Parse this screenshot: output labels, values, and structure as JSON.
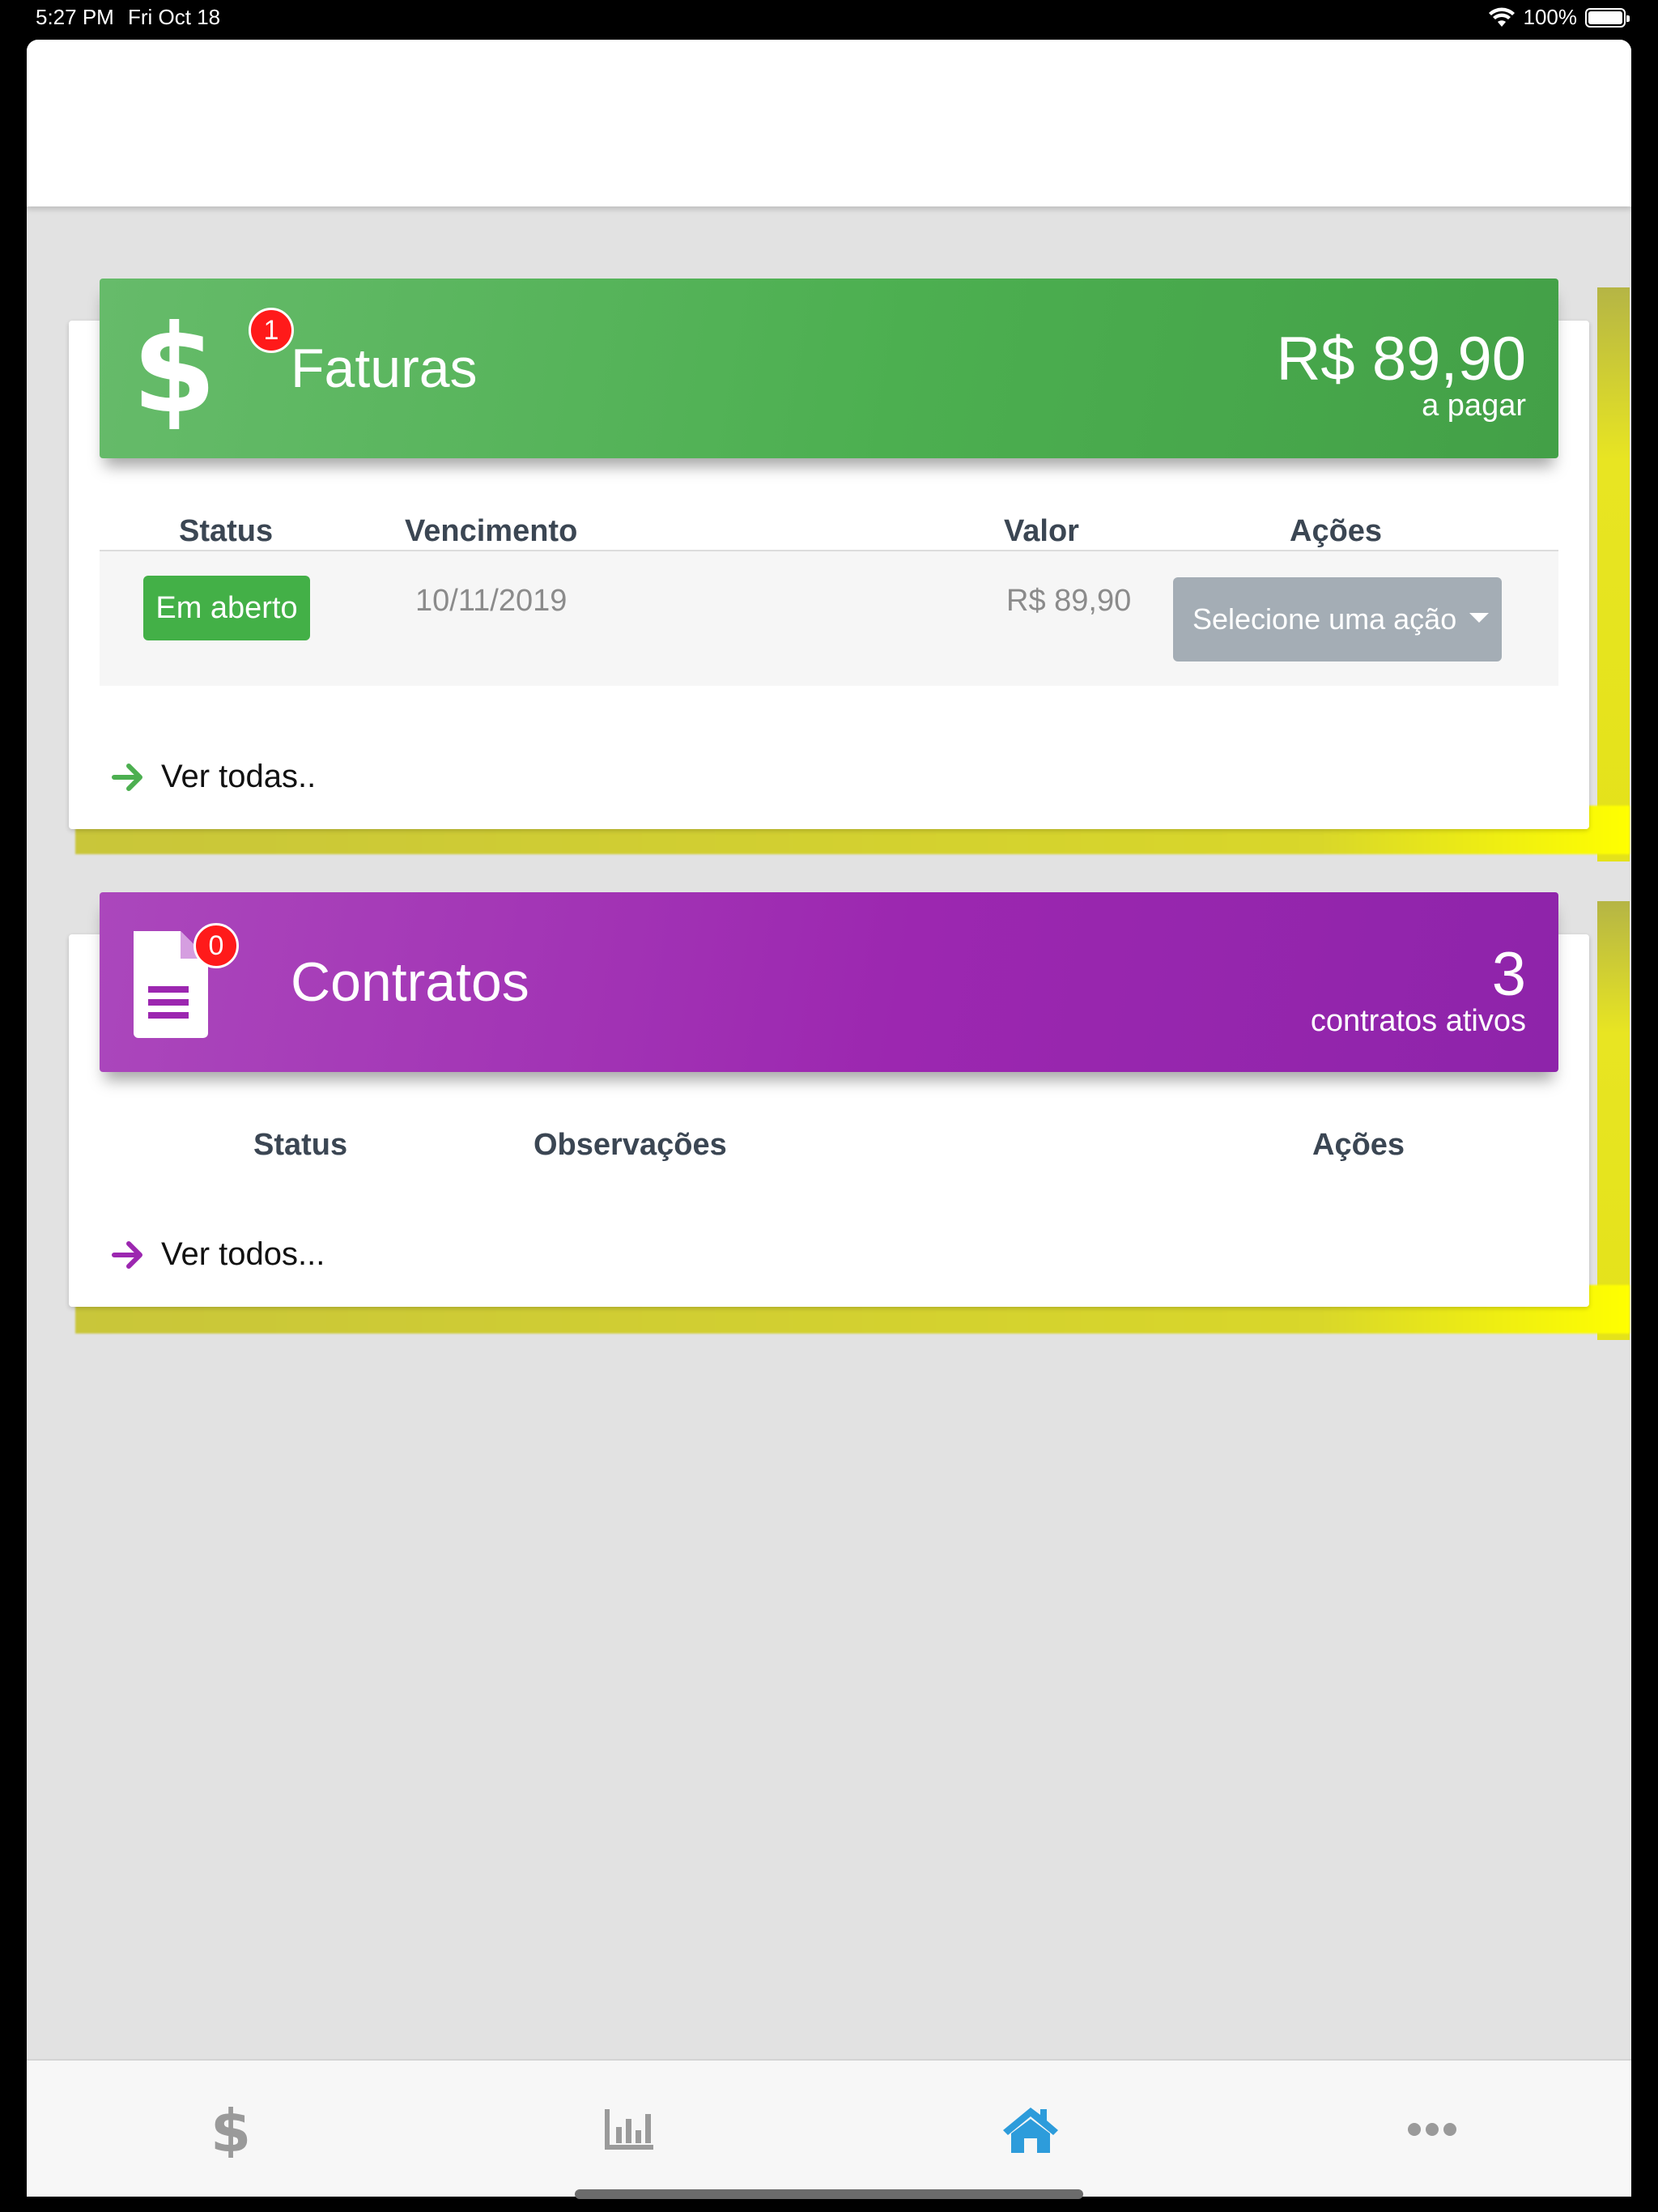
{
  "status_bar": {
    "time": "5:27 PM",
    "date": "Fri Oct 18",
    "battery": "100%"
  },
  "faturas": {
    "badge": "1",
    "title": "Faturas",
    "amount": "R$ 89,90",
    "amount_caption": "a pagar",
    "columns": [
      "Status",
      "Vencimento",
      "Valor",
      "Ações"
    ],
    "rows": [
      {
        "status": "Em aberto",
        "vencimento": "10/11/2019",
        "valor": "R$ 89,90",
        "acao": "Selecione uma ação"
      }
    ],
    "link": "Ver todas..",
    "accent": "#4caf50"
  },
  "contratos": {
    "badge": "0",
    "title": "Contratos",
    "count": "3",
    "count_caption": "contratos ativos",
    "columns": [
      "Status",
      "Observações",
      "Ações"
    ],
    "link": "Ver todos...",
    "accent": "#9c27b0"
  },
  "tab_bar": {
    "tabs": [
      {
        "name": "dollar-icon",
        "active": false
      },
      {
        "name": "bar-chart-icon",
        "active": false
      },
      {
        "name": "home-icon",
        "active": true
      },
      {
        "name": "more-icon",
        "active": false
      }
    ],
    "active_color": "#2d9cdb",
    "inactive_color": "#9a9a9a"
  }
}
